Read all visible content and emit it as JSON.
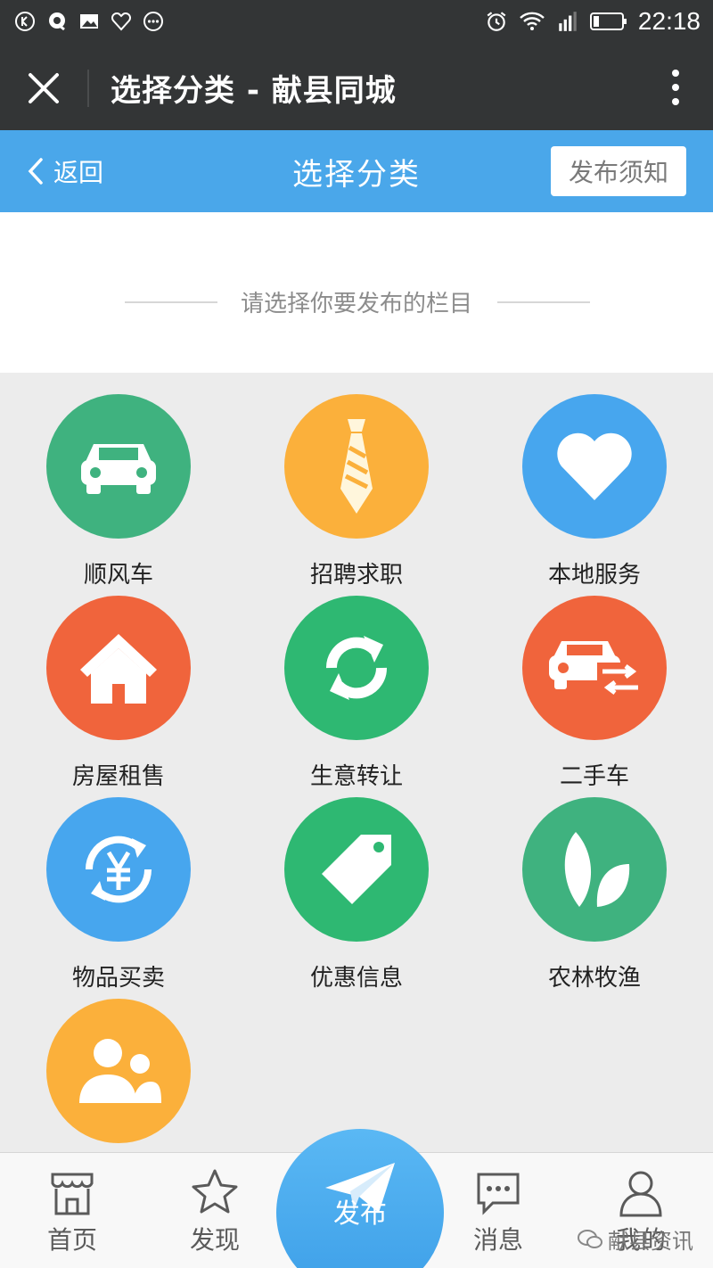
{
  "status_bar": {
    "time": "22:18"
  },
  "window": {
    "title": "选择分类 - 献县同城"
  },
  "header": {
    "back_label": "返回",
    "title": "选择分类",
    "notice_button": "发布须知"
  },
  "subtitle": "请选择你要发布的栏目",
  "categories": [
    {
      "label": "顺风车",
      "icon": "car-icon",
      "color": "#3fb27f"
    },
    {
      "label": "招聘求职",
      "icon": "tie-icon",
      "color": "#fbb03b"
    },
    {
      "label": "本地服务",
      "icon": "heart-icon",
      "color": "#47a6ee"
    },
    {
      "label": "房屋租售",
      "icon": "house-icon",
      "color": "#f0643c"
    },
    {
      "label": "生意转让",
      "icon": "refresh-icon",
      "color": "#2eb872"
    },
    {
      "label": "二手车",
      "icon": "car-transfer-icon",
      "color": "#f0643c"
    },
    {
      "label": "物品买卖",
      "icon": "yen-cycle-icon",
      "color": "#47a6ee"
    },
    {
      "label": "优惠信息",
      "icon": "tag-icon",
      "color": "#2eb872"
    },
    {
      "label": "农林牧渔",
      "icon": "leaf-icon",
      "color": "#3fb27f"
    },
    {
      "label": "",
      "icon": "users-icon",
      "color": "#fbb03b"
    }
  ],
  "bottom_nav": {
    "home": "首页",
    "discover": "发现",
    "publish": "发布",
    "messages": "消息",
    "mine": "我的"
  },
  "watermark": "献县资讯"
}
